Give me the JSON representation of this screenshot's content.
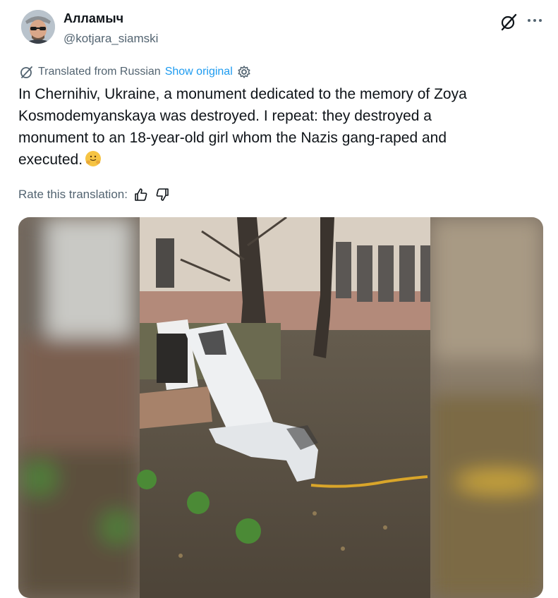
{
  "author": {
    "display_name": "Алламыч",
    "handle": "@kotjara_siamski"
  },
  "header_icons": [
    "grok-icon",
    "more-options-icon"
  ],
  "translation": {
    "label": "Translated from Russian",
    "show_original": "Show original",
    "icons": [
      "translate-icon",
      "gear-icon"
    ]
  },
  "tweet": {
    "lines": [
      "In Chernihiv, Ukraine, a monument dedicated to the memory of Zoya",
      "Kosmodemyanskaya was destroyed. I repeat: they destroyed a",
      "monument to an 18-year-old girl whom the Nazis gang-raped and",
      "executed."
    ],
    "emoji": "hugging-face-emoji"
  },
  "rating": {
    "label": "Rate this translation:",
    "icons": [
      "thumbs-up-icon",
      "thumbs-down-icon"
    ]
  },
  "media": {
    "kind": "video-frame",
    "description_icon": "toppled-statue-photo"
  },
  "colors": {
    "link": "#1d9bf0",
    "secondary_text": "#536471",
    "primary_text": "#0f1419"
  }
}
